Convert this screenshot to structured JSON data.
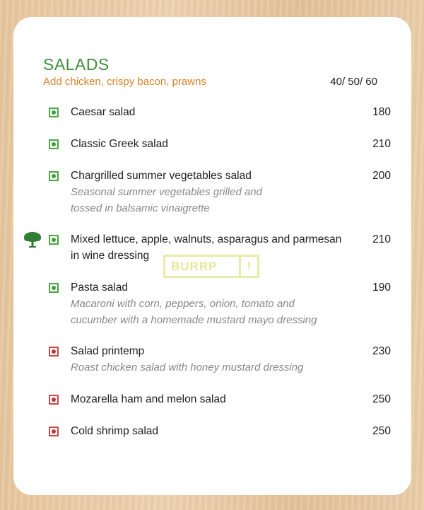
{
  "section": {
    "title": "SALADS",
    "subtitle": "Add chicken, crispy bacon, prawns",
    "addon_prices": "40/ 50/ 60"
  },
  "items": [
    {
      "name": "Caesar salad",
      "description": "",
      "price": "180",
      "type": "veg"
    },
    {
      "name": "Classic Greek salad",
      "description": "",
      "price": "210",
      "type": "veg"
    },
    {
      "name": "Chargrilled summer vegetables salad",
      "description_lines": [
        "Seasonal summer vegetables grilled and",
        "tossed in balsamic vinaigrette"
      ],
      "price": "200",
      "type": "veg"
    },
    {
      "name_lines": [
        "Mixed lettuce, apple, walnuts, asparagus and parmesan",
        "in wine dressing"
      ],
      "price": "210",
      "type": "veg",
      "icon": "tree-icon"
    },
    {
      "name": "Pasta salad",
      "description_lines": [
        "Macaroni with corn, peppers, onion, tomato and",
        "cucumber with a homemade mustard mayo dressing"
      ],
      "price": "190",
      "type": "veg"
    },
    {
      "name": "Salad printemp",
      "description_lines": [
        "Roast chicken salad with honey mustard dressing"
      ],
      "price": "230",
      "type": "non-veg"
    },
    {
      "name": "Mozarella ham and melon salad",
      "price": "250",
      "type": "non-veg"
    },
    {
      "name": "Cold shrimp salad",
      "price": "250",
      "type": "non-veg"
    }
  ],
  "watermark": {
    "text": "BURRP",
    "mark": "!"
  },
  "colors": {
    "title": "#3f8f3a",
    "subtitle": "#d9822b",
    "veg": "#35a338",
    "non_veg": "#d22d2d",
    "background": "#e8c9a3"
  }
}
